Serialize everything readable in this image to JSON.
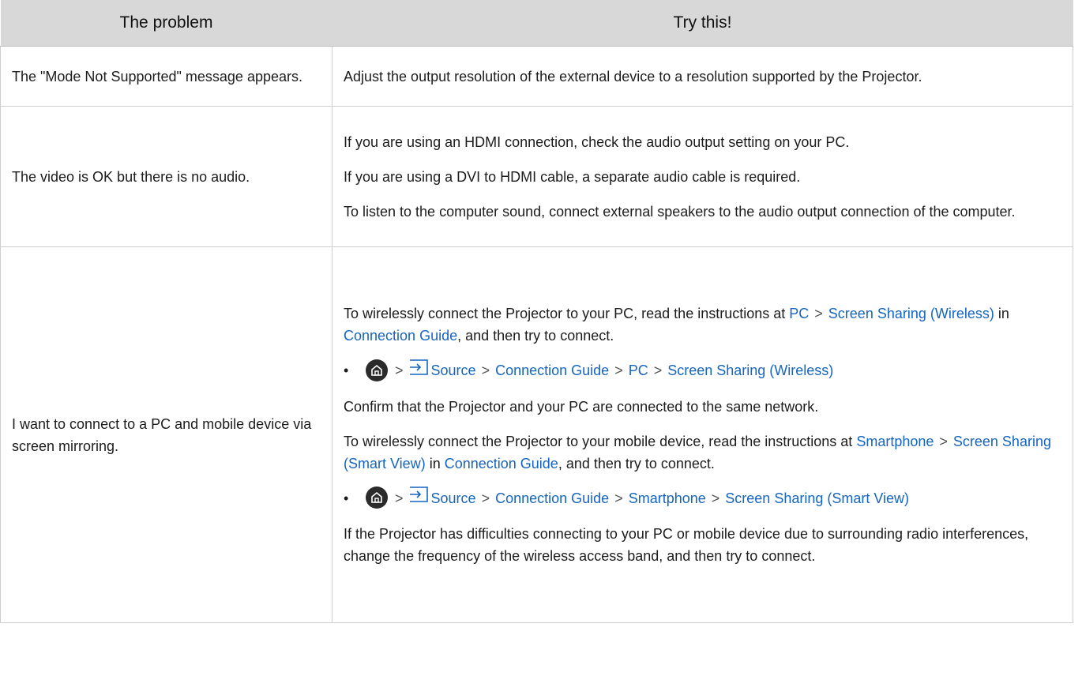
{
  "header": {
    "col1": "The problem",
    "col2": "Try this!"
  },
  "row1": {
    "problem": "The \"Mode Not Supported\" message appears.",
    "solution": "Adjust the output resolution of the external device to a resolution supported by the Projector."
  },
  "row2": {
    "problem": "The video is OK but there is no audio.",
    "p1": "If you are using an HDMI connection, check the audio output setting on your PC.",
    "p2": "If you are using a DVI to HDMI cable, a separate audio cable is required.",
    "p3": "To listen to the computer sound, connect external speakers to the audio output connection of the computer."
  },
  "row3": {
    "problem": "I want to connect to a PC and mobile device via screen mirroring.",
    "p1_a": "To wirelessly connect the Projector to your PC, read the instructions at ",
    "p1_link1": "PC",
    "p1_link2": "Screen Sharing (Wireless)",
    "p1_b": " in ",
    "p1_link3": "Connection Guide",
    "p1_c": ", and then try to connect.",
    "path1": [
      "Source",
      "Connection Guide",
      "PC",
      "Screen Sharing (Wireless)"
    ],
    "p2": "Confirm that the Projector and your PC are connected to the same network.",
    "p3_a": "To wirelessly connect the Projector to your mobile device, read the instructions at ",
    "p3_link1": "Smartphone",
    "p3_link2": "Screen Sharing (Smart View)",
    "p3_b": " in ",
    "p3_link3": "Connection Guide",
    "p3_c": ", and then try to connect.",
    "path2": [
      "Source",
      "Connection Guide",
      "Smartphone",
      "Screen Sharing (Smart View)"
    ],
    "p4": "If the Projector has difficulties connecting to your PC or mobile device due to surrounding radio interferences, change the frequency of the wireless access band, and then try to connect."
  },
  "ui": {
    "separator": ">",
    "bullet": "•",
    "link_color": "#1565c0",
    "header_bg": "#d8d8d8"
  },
  "icons": {
    "home": "home-icon",
    "source": "source-icon"
  }
}
